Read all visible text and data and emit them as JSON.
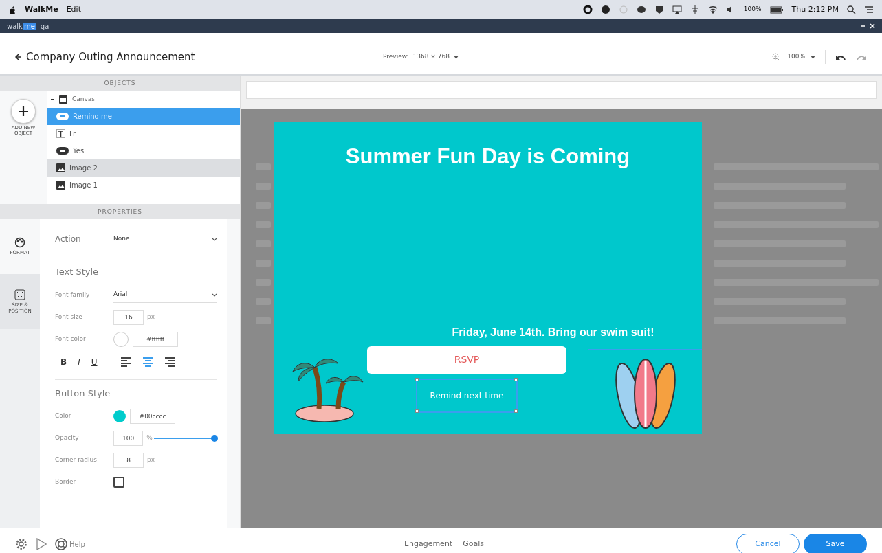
{
  "menubar": {
    "app": "WalkMe",
    "menus": [
      "Edit"
    ],
    "battery": "100%",
    "clock": "Thu 2:12 PM"
  },
  "app_bar": {
    "logo": [
      "walk",
      "me"
    ],
    "workspace": "qa"
  },
  "header": {
    "title": "Company Outing Announcement",
    "preview_label": "Preview:",
    "preview_size": "1368 × 768",
    "zoom": "100%"
  },
  "objects": {
    "title": "OBJECTS",
    "add_label": "ADD NEW OBJECT",
    "tree": [
      {
        "label": "Canvas",
        "kind": "canvas",
        "expanded": true,
        "children": [
          {
            "label": "Remind me",
            "kind": "button",
            "selected": true,
            "hovered": false
          },
          {
            "label": "Fr",
            "kind": "text",
            "selected": false,
            "hovered": false
          },
          {
            "label": "Yes",
            "kind": "button",
            "selected": false,
            "hovered": false
          },
          {
            "label": "Image 2",
            "kind": "image",
            "selected": false,
            "hovered": true
          },
          {
            "label": "Image 1",
            "kind": "image",
            "selected": false,
            "hovered": false
          }
        ]
      }
    ]
  },
  "properties": {
    "title": "PROPERTIES",
    "tabs": [
      {
        "label": "FORMAT",
        "kind": "format",
        "selected": true
      },
      {
        "label": "SIZE & POSITION",
        "kind": "size",
        "selected": false
      }
    ],
    "action": {
      "label": "Action",
      "value": "None"
    },
    "text_style": {
      "heading": "Text Style",
      "font_family_label": "Font family",
      "font_family": "Arial",
      "font_size_label": "Font size",
      "font_size": "16",
      "font_size_unit": "px",
      "font_color_label": "Font color",
      "font_color": "#ffffff",
      "format_buttons": [
        {
          "label": "B",
          "kind": "bold",
          "selected": false
        },
        {
          "label": "I",
          "kind": "italic",
          "selected": false
        },
        {
          "label": "U",
          "kind": "underline",
          "selected": false
        }
      ],
      "align": [
        {
          "kind": "left",
          "selected": false
        },
        {
          "kind": "center",
          "selected": true
        },
        {
          "kind": "right",
          "selected": false
        }
      ]
    },
    "button_style": {
      "heading": "Button Style",
      "color_label": "Color",
      "color": "#00cccc",
      "opacity_label": "Opacity",
      "opacity": "100",
      "opacity_unit": "%",
      "level": 1,
      "radius_label": "Corner radius",
      "radius": "8",
      "radius_unit": "px",
      "border_label": "Border",
      "border_checked": false
    }
  },
  "popup": {
    "title": "Summer Fun Day is Coming",
    "subtitle": "Friday, June 14th. Bring our swim suit!",
    "buttons": [
      {
        "label": "RSVP",
        "kind": "light",
        "selected": false
      },
      {
        "label": "Remind next time",
        "kind": "outline",
        "selected": true
      }
    ]
  },
  "footer": {
    "help": "Help",
    "tabs": [
      "Engagement",
      "Goals"
    ],
    "cancel": "Cancel",
    "save": "Save"
  }
}
